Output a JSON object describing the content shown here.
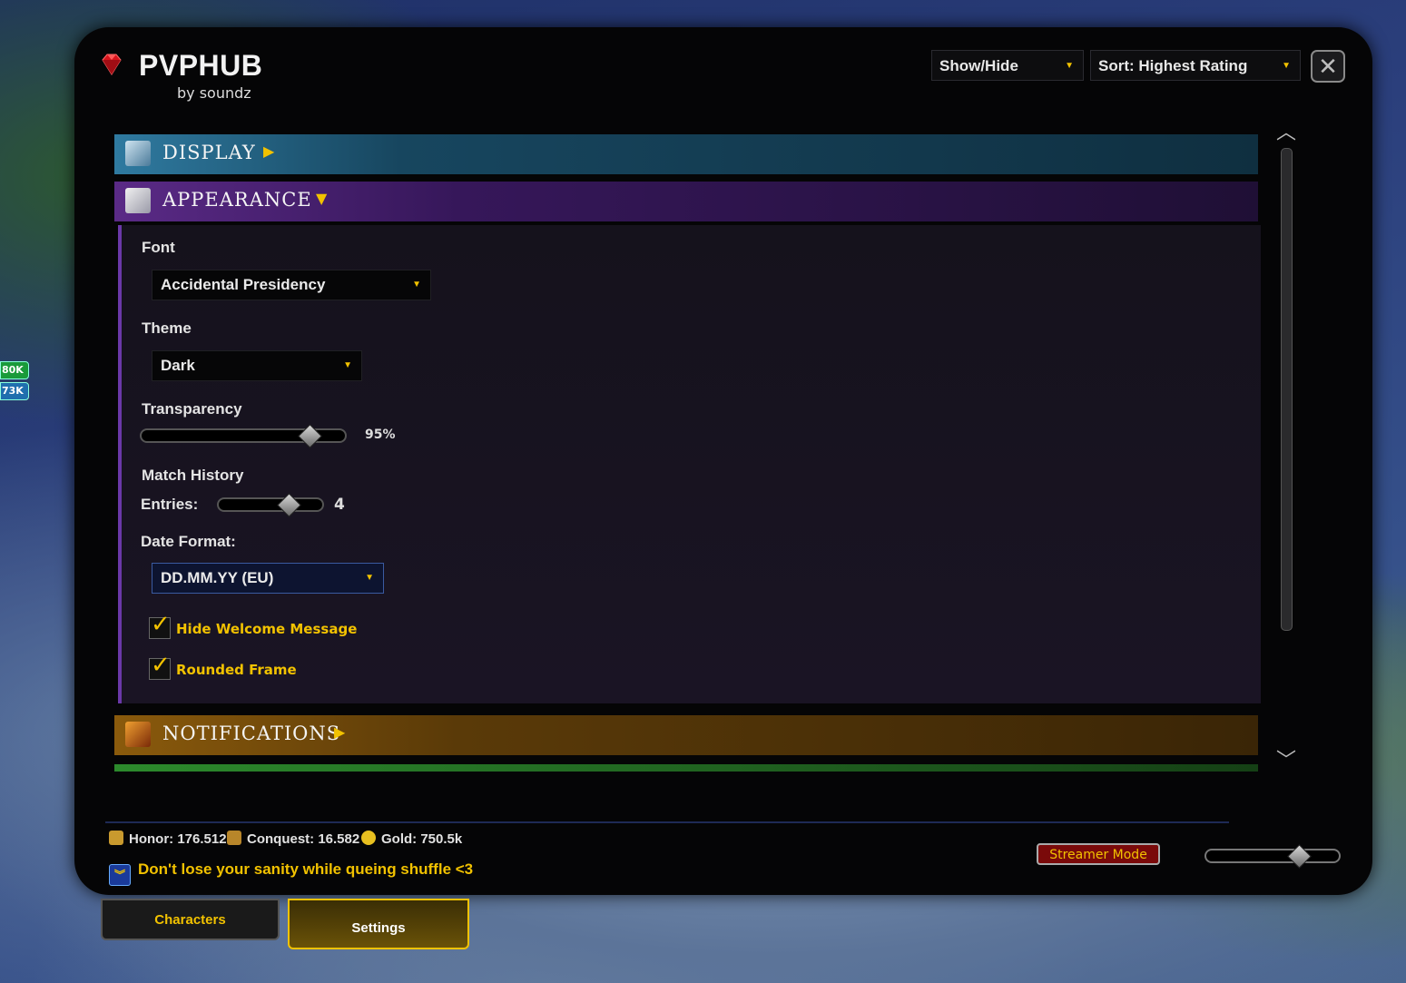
{
  "app": {
    "title": "PVPHUB",
    "subtitle": "by soundz"
  },
  "toolbar": {
    "show_hide_label": "Show/Hide",
    "sort_label": "Sort: Highest Rating",
    "close_icon": "close-icon"
  },
  "unit_frame": {
    "hp": "80K",
    "mp": "73K"
  },
  "sections": {
    "display": {
      "label": "DISPLAY",
      "expanded": false
    },
    "appearance": {
      "label": "APPEARANCE",
      "expanded": true
    },
    "notifications": {
      "label": "NOTIFICATIONS",
      "expanded": false
    }
  },
  "appearance": {
    "font_label": "Font",
    "font_value": "Accidental Presidency",
    "theme_label": "Theme",
    "theme_value": "Dark",
    "transparency_label": "Transparency",
    "transparency_value": "95%",
    "transparency_level": 0.85,
    "match_history_label": "Match History",
    "entries_label": "Entries:",
    "entries_value": "4",
    "entries_level": 0.7,
    "date_format_label": "Date Format:",
    "date_format_value": "DD.MM.YY (EU)",
    "hide_welcome_label": "Hide Welcome Message",
    "hide_welcome_checked": true,
    "rounded_frame_label": "Rounded Frame",
    "rounded_frame_checked": true
  },
  "footer": {
    "honor": "Honor: 176.512",
    "conquest": "Conquest: 16.582",
    "gold": "Gold: 750.5k",
    "tip": "Don't lose your sanity while queing shuffle <3",
    "streamer_mode_label": "Streamer Mode",
    "scale_level": 0.72
  },
  "tabs": {
    "characters": "Characters",
    "settings": "Settings"
  },
  "colors": {
    "accent": "#f2c200",
    "display_header": "#2f7aa0",
    "appearance_header": "#5a2a86",
    "notifications_header": "#8a5a0c"
  }
}
